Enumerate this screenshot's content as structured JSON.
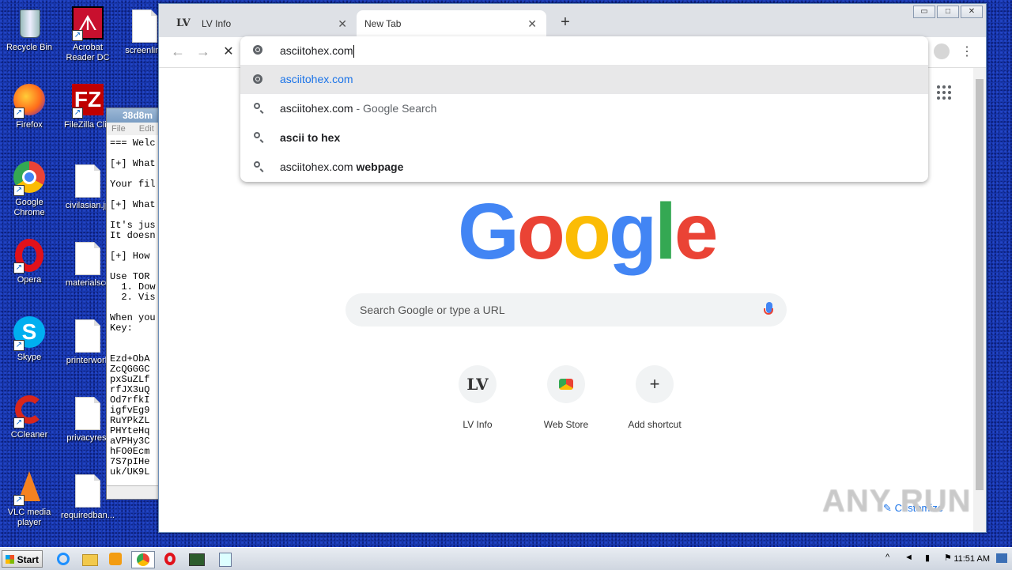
{
  "desktop": {
    "icons": [
      {
        "label": "Recycle Bin"
      },
      {
        "label": "Acrobat Reader DC"
      },
      {
        "label": "screenlimi"
      },
      {
        "label": "Firefox"
      },
      {
        "label": "FileZilla Clie"
      },
      {
        "label": "Google Chrome"
      },
      {
        "label": "civilasian.jp"
      },
      {
        "label": "Opera"
      },
      {
        "label": "materialsco"
      },
      {
        "label": "Skype"
      },
      {
        "label": "printerwork"
      },
      {
        "label": "CCleaner"
      },
      {
        "label": "privacyrest"
      },
      {
        "label": "VLC media player"
      },
      {
        "label": "requiredban..."
      }
    ]
  },
  "notepad": {
    "title": "38d8m",
    "menu": [
      "File",
      "Edit"
    ],
    "text": "=== Welc\n\n[+] What\n\nYour fil\n\n[+] What\n\nIt's jus\nIt doesn\n\n[+] How\n\nUse TOR\n  1. Dow\n  2. Vis\n\nWhen you\nKey:\n\n\nEzd+ObA\nZcQGGGC\npxSuZLf\nrfJX3uQ\nOd7rfkI\nigfvEg9\nRuYPkZL\nPHYteHq\naVPHy3C\nhFO0Ecm\n7S7pIHe\nuk/UK9L"
  },
  "chrome": {
    "tabs": [
      {
        "title": "LV Info",
        "favicon": "LV"
      },
      {
        "title": "New Tab"
      }
    ],
    "new_tab_symbol": "+",
    "window_buttons": [
      "▭",
      "□",
      "✕"
    ],
    "nav": {
      "back": "←",
      "forward": "→",
      "stop": "✕"
    },
    "omnibox": {
      "value": "asciitohex.com",
      "suggestions": [
        {
          "main": "asciitohex.com",
          "suffix": "",
          "icon": "globe-icon",
          "selected": true
        },
        {
          "main": "asciitohex.com",
          "suffix": " - Google Search",
          "icon": "search-icon"
        },
        {
          "main": "ascii to hex",
          "suffix": "",
          "icon": "search-icon"
        },
        {
          "main": "asciitohex.com ",
          "suffix": "webpage",
          "icon": "search-icon"
        }
      ]
    },
    "ntp": {
      "logo_letters": [
        "G",
        "o",
        "o",
        "g",
        "l",
        "e"
      ],
      "logo_colors": [
        "#4285f4",
        "#ea4335",
        "#fbbc05",
        "#4285f4",
        "#34a853",
        "#ea4335"
      ],
      "search_placeholder": "Search Google or type a URL",
      "shortcuts": [
        {
          "label": "LV Info",
          "glyph": "LV"
        },
        {
          "label": "Web Store",
          "glyph": ""
        },
        {
          "label": "Add shortcut",
          "glyph": "+"
        }
      ],
      "customize_label": "Customize"
    }
  },
  "taskbar": {
    "start_label": "Start",
    "clock": "11:51 AM"
  },
  "watermark": "ANY RUN"
}
